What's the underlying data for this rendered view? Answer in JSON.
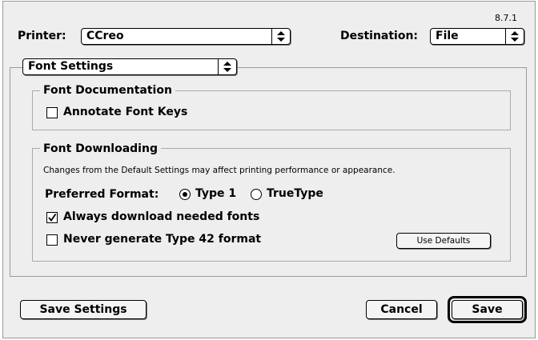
{
  "version": "8.7.1",
  "printer": {
    "label": "Printer:",
    "value": "CCreo"
  },
  "destination": {
    "label": "Destination:",
    "value": "File"
  },
  "panel": {
    "value": "Font Settings"
  },
  "font_documentation": {
    "title": "Font Documentation",
    "annotate": {
      "label": "Annotate Font Keys",
      "checked": false
    }
  },
  "font_downloading": {
    "title": "Font Downloading",
    "note": "Changes from the Default Settings may affect printing performance or appearance.",
    "preferred_format": {
      "label": "Preferred Format:",
      "options": [
        "Type 1",
        "TrueType"
      ],
      "selected": "Type 1"
    },
    "always_download": {
      "label": "Always download needed fonts",
      "checked": true
    },
    "never_generate": {
      "label": "Never generate Type 42 format",
      "checked": false
    },
    "use_defaults_label": "Use Defaults"
  },
  "buttons": {
    "save_settings": "Save Settings",
    "cancel": "Cancel",
    "save": "Save"
  },
  "icons": {
    "popup_arrows": "up-down-arrows-icon",
    "checkmark": "checkmark-icon"
  }
}
